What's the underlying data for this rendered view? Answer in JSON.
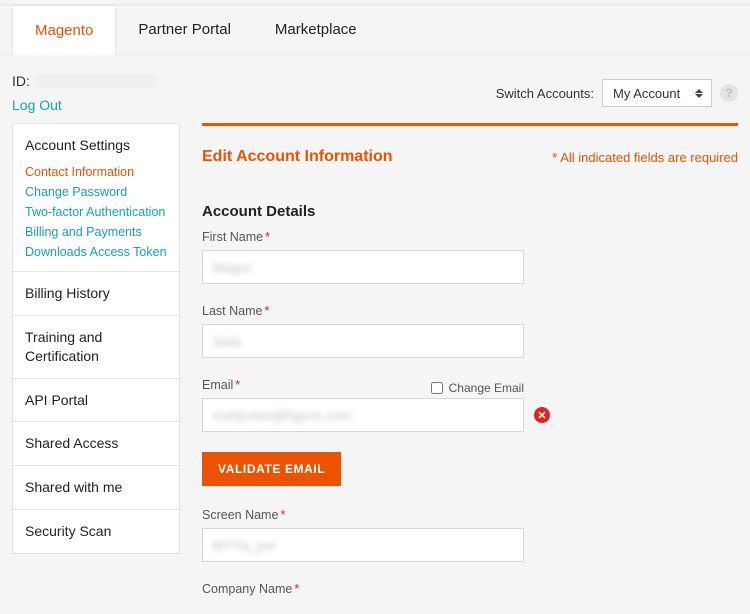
{
  "tabs": {
    "magento": "Magento",
    "partner": "Partner Portal",
    "marketplace": "Marketplace"
  },
  "meta": {
    "id_label": "ID:",
    "logout": "Log Out",
    "switch_label": "Switch Accounts:",
    "switch_value": "My Account"
  },
  "sidebar": {
    "account_settings": {
      "title": "Account Settings",
      "links": {
        "contact": "Contact Information",
        "password": "Change Password",
        "twofa": "Two-factor Authentication",
        "billing_pay": "Billing and Payments",
        "downloads_token": "Downloads Access Token"
      }
    },
    "billing_history": "Billing History",
    "training": "Training and Certification",
    "api_portal": "API Portal",
    "shared_access": "Shared Access",
    "shared_with_me": "Shared with me",
    "security_scan": "Security Scan"
  },
  "main": {
    "heading": "Edit Account Information",
    "required_note": "* All indicated fields are required",
    "section_title": "Account Details",
    "labels": {
      "first_name": "First Name",
      "last_name": "Last Name",
      "email": "Email",
      "change_email": "Change Email",
      "screen_name": "Screen Name",
      "company_name": "Company Name",
      "asterisk": "*"
    },
    "validate_btn": "VALIDATE EMAIL",
    "values": {
      "first_name": "Mugur",
      "last_name": "Sala",
      "email": "mailjunko@figure.com",
      "screen_name": "MYYa_jon"
    }
  }
}
